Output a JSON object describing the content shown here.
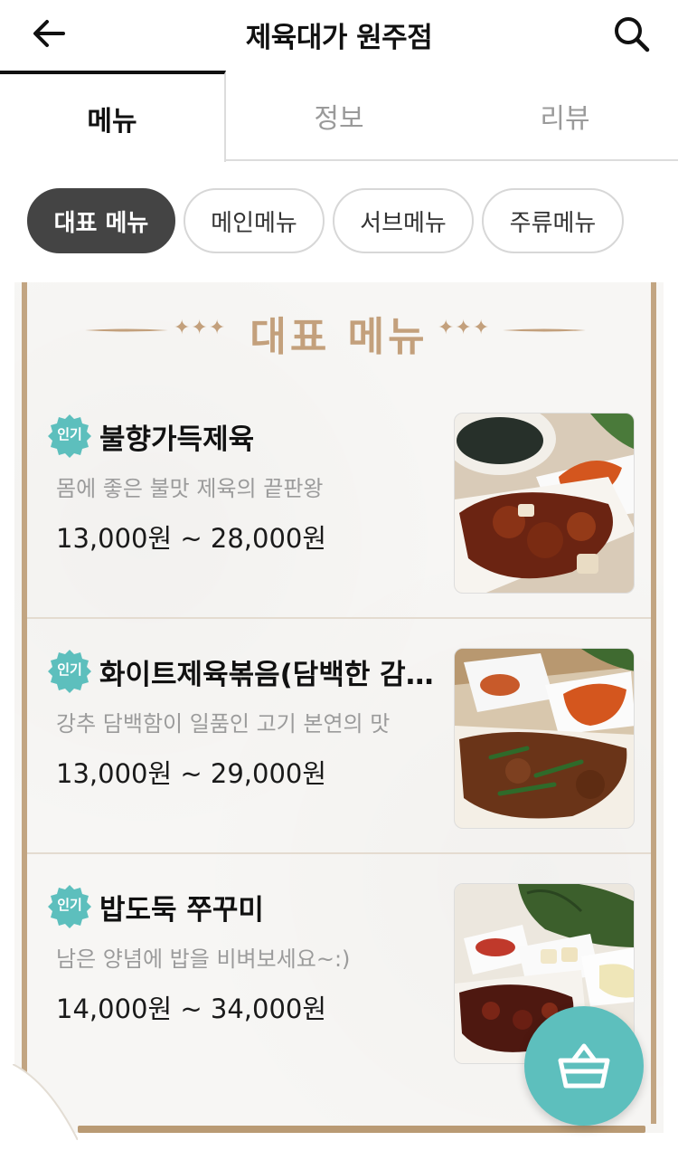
{
  "header": {
    "title": "제육대가 원주점",
    "back_icon": "arrow-left-icon",
    "search_icon": "search-icon"
  },
  "tabs": [
    {
      "label": "메뉴",
      "active": true
    },
    {
      "label": "정보",
      "active": false
    },
    {
      "label": "리뷰",
      "active": false
    }
  ],
  "chips": [
    {
      "label": "대표 메뉴",
      "active": true
    },
    {
      "label": "메인메뉴",
      "active": false
    },
    {
      "label": "서브메뉴",
      "active": false
    },
    {
      "label": "주류메뉴",
      "active": false
    }
  ],
  "board": {
    "title": "대표 메뉴",
    "accent_color": "#c3a07c",
    "items": [
      {
        "badge": "인기",
        "name": "불향가득제육",
        "desc": "몸에 좋은 불맛 제육의 끝판왕",
        "price": "13,000원 ~ 28,000원",
        "image_icon": "spicy-pork-photo"
      },
      {
        "badge": "인기",
        "name": "화이트제육볶음(담백한 감칠맛)",
        "desc": "강추 담백함이 일품인 고기 본연의 맛",
        "price": "13,000원 ~ 29,000원",
        "image_icon": "white-pork-photo"
      },
      {
        "badge": "인기",
        "name": "밥도둑 쭈꾸미",
        "desc": "남은 양념에 밥을 비벼보세요~:)",
        "price": "14,000원 ~ 34,000원",
        "image_icon": "webfoot-octopus-photo"
      }
    ]
  },
  "cart": {
    "icon": "shopping-basket-icon",
    "color": "#5dbfbd"
  },
  "colors": {
    "badge": "#5dbfbd",
    "chip_active": "#444444"
  }
}
